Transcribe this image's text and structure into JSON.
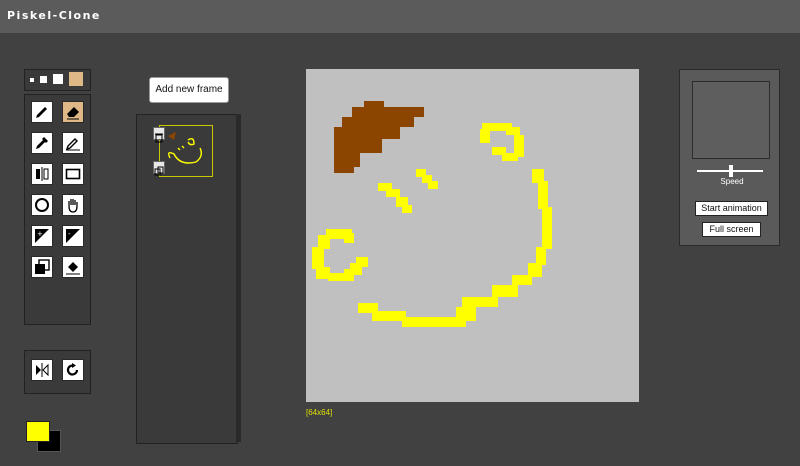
{
  "app": {
    "title": "Piskel-Clone"
  },
  "frames": {
    "add_label": "Add new frame"
  },
  "canvas": {
    "dimensions_label": "[64x64]",
    "background": "#c0c0c0"
  },
  "preview": {
    "speed_label": "Speed",
    "speed_value": 0.5,
    "start_label": "Start animation",
    "fullscreen_label": "Full screen"
  },
  "colors": {
    "primary": "#ffff00",
    "secondary": "#000000",
    "selected_tool": "#deb887"
  },
  "tools": [
    "pen-icon",
    "eraser-icon",
    "eyedropper-icon",
    "stroke-icon",
    "mirror-icon",
    "rectangle-icon",
    "circle-icon",
    "move-hand-icon",
    "lighten-icon",
    "darken-icon",
    "select-copy-icon",
    "paint-bucket-icon"
  ],
  "actions": [
    "flip-icon",
    "rotate-icon"
  ]
}
